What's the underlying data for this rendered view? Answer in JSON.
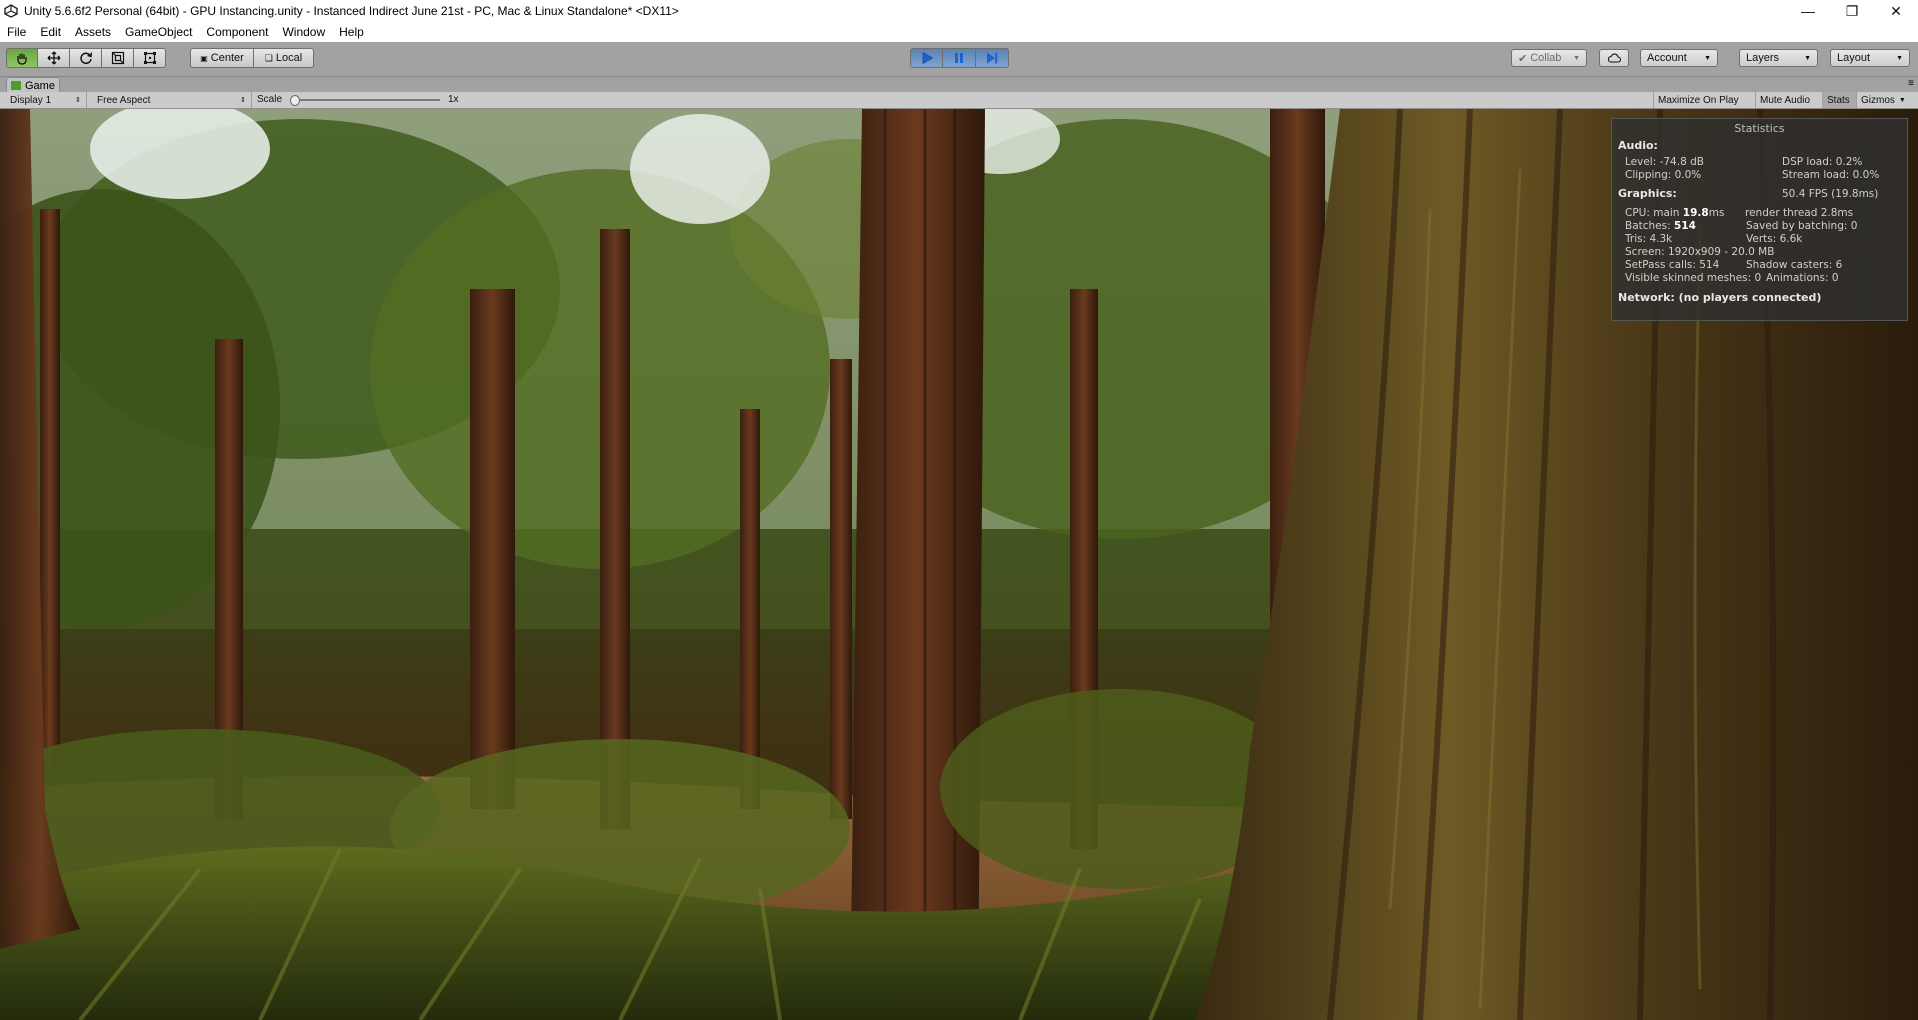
{
  "window": {
    "title": "Unity 5.6.6f2 Personal (64bit) - GPU Instancing.unity - Instanced Indirect June 21st - PC, Mac & Linux Standalone* <DX11>",
    "minimize_icon": "minimize-icon",
    "restore_icon": "restore-icon",
    "close_icon": "close-icon"
  },
  "menu": [
    "File",
    "Edit",
    "Assets",
    "GameObject",
    "Component",
    "Window",
    "Help"
  ],
  "toolbar": {
    "transform_tools": [
      "hand-icon",
      "move-icon",
      "rotate-icon",
      "scale-icon",
      "rect-tool-icon"
    ],
    "pivot_mode": "Center",
    "pivot_rotation": "Local",
    "play_controls": [
      "play-icon",
      "pause-icon",
      "step-icon"
    ],
    "collab": "Collab",
    "account": "Account",
    "layers": "Layers",
    "layout": "Layout"
  },
  "game_tab": {
    "label": "Game"
  },
  "game_toolbar": {
    "display": "Display 1",
    "aspect": "Free Aspect",
    "scale_label": "Scale",
    "scale_value": "1x",
    "scale_level": 0,
    "maximize_on_play": "Maximize On Play",
    "mute_audio": "Mute Audio",
    "stats": "Stats",
    "gizmos": "Gizmos"
  },
  "statistics": {
    "title": "Statistics",
    "audio_heading": "Audio:",
    "level": "Level: -74.8 dB",
    "dsp_load": "DSP load: 0.2%",
    "clipping": "Clipping: 0.0%",
    "stream_load": "Stream load: 0.0%",
    "graphics_heading": "Graphics:",
    "fps": "50.4 FPS (19.8ms)",
    "cpu_label": "CPU: main ",
    "cpu_main": "19.8",
    "cpu_unit": "ms",
    "render_thread": "render thread 2.8ms",
    "batches_label": "Batches: ",
    "batches_value": "514",
    "saved_by_batching": "Saved by batching: 0",
    "tris": "Tris: 4.3k",
    "verts": "Verts: 6.6k",
    "screen": "Screen: 1920x909 - 20.0 MB",
    "setpass": "SetPass calls: 514",
    "shadow_casters": "Shadow casters: 6",
    "visible_skinned": "Visible skinned meshes: 0",
    "animations": "Animations: 0",
    "network": "Network: (no players connected)"
  }
}
